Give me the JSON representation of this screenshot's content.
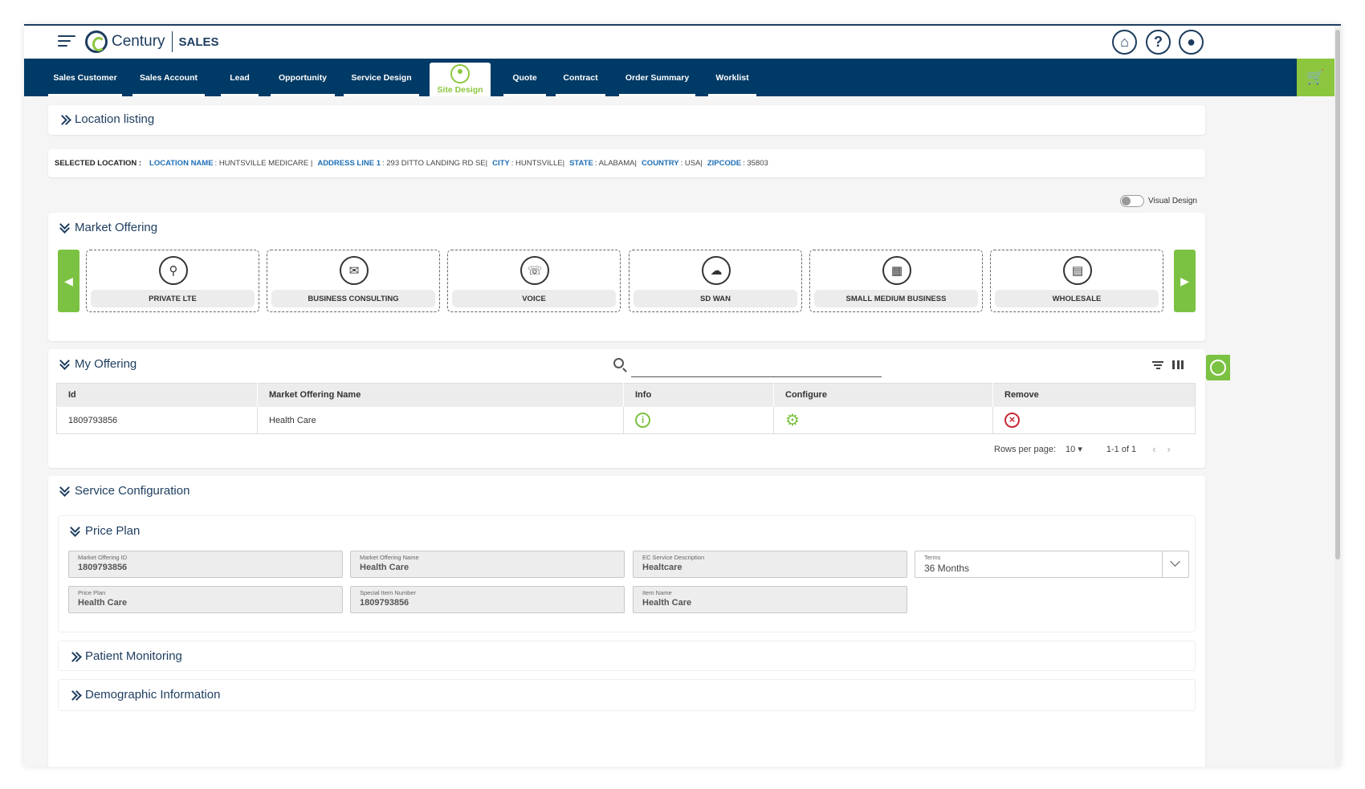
{
  "header": {
    "brand": "Century",
    "app": "SALES",
    "icons": [
      "home-icon",
      "help-icon",
      "user-icon"
    ]
  },
  "nav": {
    "tabs": [
      {
        "label": "Sales Customer"
      },
      {
        "label": "Sales Account"
      },
      {
        "label": "Lead"
      },
      {
        "label": "Opportunity"
      },
      {
        "label": "Service Design"
      },
      {
        "label": "Site Design",
        "active": true
      },
      {
        "label": "Quote"
      },
      {
        "label": "Contract"
      },
      {
        "label": "Order Summary"
      },
      {
        "label": "Worklist"
      }
    ],
    "cart_icon": "cart-icon"
  },
  "location_listing": {
    "title": "Location listing"
  },
  "selected_location": {
    "label": "SELECTED LOCATION :",
    "location_name_key": "LOCATION NAME",
    "location_name": ": HUNTSVILLE MEDICARE",
    "address_key": "ADDRESS LINE 1",
    "address": ": 293 DITTO LANDING RD SE",
    "city_key": "CITY",
    "city": ": HUNTSVILLE",
    "state_key": "STATE",
    "state": ": ALABAMA",
    "country_key": "COUNTRY",
    "country": ": USA",
    "zip_key": "ZIPCODE",
    "zip": ": 35803"
  },
  "visual_design": {
    "label": "Visual Design",
    "enabled": false
  },
  "market_offering": {
    "title": "Market Offering",
    "tiles": [
      {
        "label": "PRIVATE LTE",
        "icon": "antenna-icon"
      },
      {
        "label": "BUSINESS CONSULTING",
        "icon": "chat-icon"
      },
      {
        "label": "VOICE",
        "icon": "phone-icon"
      },
      {
        "label": "SD WAN",
        "icon": "cloud-network-icon"
      },
      {
        "label": "SMALL MEDIUM BUSINESS",
        "icon": "storefront-icon"
      },
      {
        "label": "WHOLESALE",
        "icon": "boxes-icon"
      }
    ]
  },
  "my_offering": {
    "title": "My Offering",
    "search_placeholder": "",
    "columns": [
      "Id",
      "Market Offering Name",
      "Info",
      "Configure",
      "Remove"
    ],
    "rows": [
      {
        "id": "1809793856",
        "name": "Health Care"
      }
    ],
    "pager": {
      "rows_label": "Rows per page:",
      "rows_value": "10",
      "range": "1-1 of 1"
    }
  },
  "service_configuration": {
    "title": "Service Configuration",
    "price_plan": {
      "title": "Price Plan",
      "fields": [
        {
          "label": "Market Offering ID",
          "value": "1809793856"
        },
        {
          "label": "Market Offering Name",
          "value": "Health Care"
        },
        {
          "label": "EC Service Description",
          "value": "Healtcare"
        },
        {
          "label": "Terms",
          "value": "36 Months"
        },
        {
          "label": "Price Plan",
          "value": "Health Care"
        },
        {
          "label": "Special Item Number",
          "value": "1809793856"
        },
        {
          "label": "Item Name",
          "value": "Health Care"
        }
      ]
    },
    "patient_monitoring": {
      "title": "Patient Monitoring"
    },
    "demographic_information": {
      "title": "Demographic Information"
    }
  },
  "colors": {
    "navy": "#003a66",
    "accent_green": "#7cc242",
    "link_blue": "#1f6fb5",
    "remove_red": "#c62836"
  }
}
